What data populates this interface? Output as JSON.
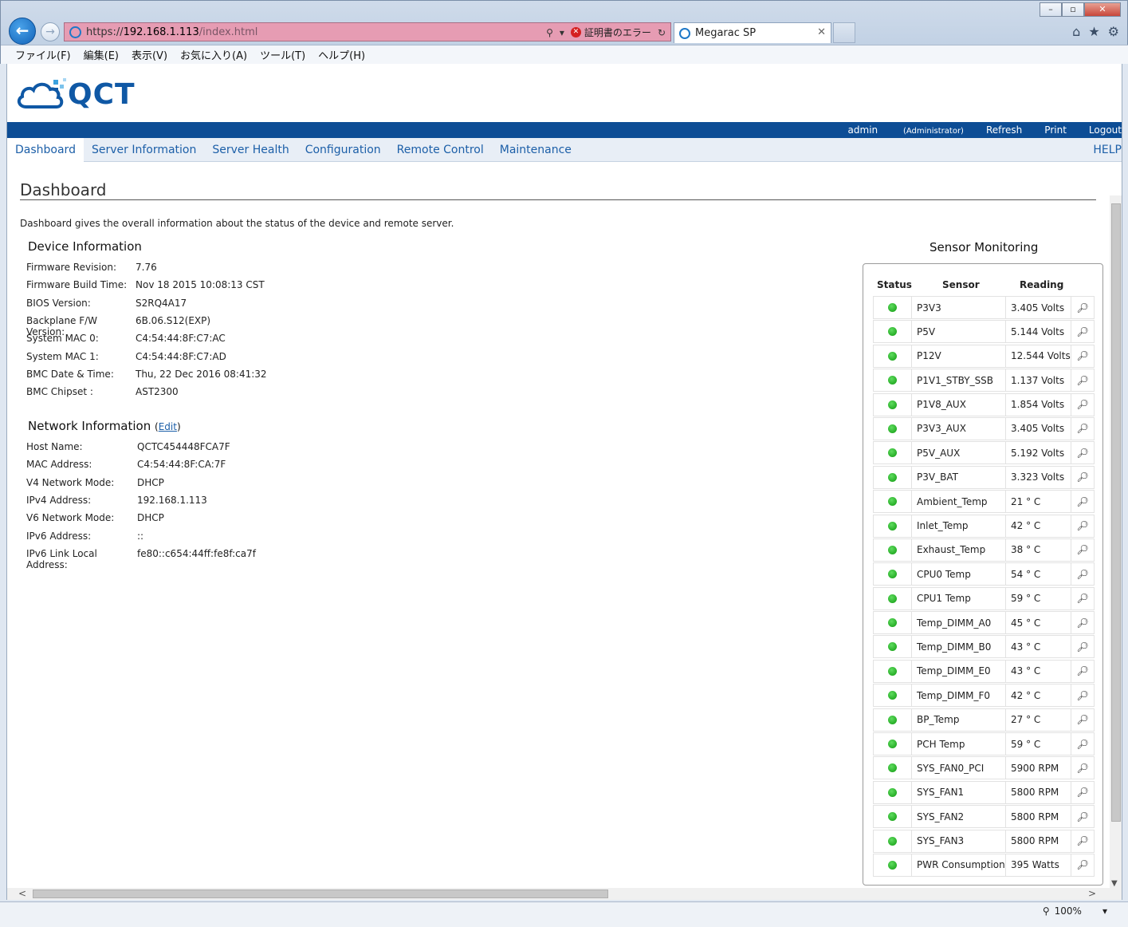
{
  "browser": {
    "url_prefix": "https://",
    "url_host": "192.168.1.113",
    "url_path": "/index.html",
    "cert_error": "証明書のエラー",
    "tab_title": "Megarac SP",
    "menus": [
      "ファイル(F)",
      "編集(E)",
      "表示(V)",
      "お気に入り(A)",
      "ツール(T)",
      "ヘルプ(H)"
    ],
    "zoom": "100%"
  },
  "header": {
    "logo": "QCT",
    "user": "admin",
    "role": "(Administrator)",
    "refresh": "Refresh",
    "print": "Print",
    "logout": "Logout"
  },
  "nav": {
    "items": [
      "Dashboard",
      "Server Information",
      "Server Health",
      "Configuration",
      "Remote Control",
      "Maintenance"
    ],
    "help": "HELP"
  },
  "page": {
    "title": "Dashboard",
    "description": "Dashboard gives the overall information about the status of the device and remote server."
  },
  "device": {
    "heading": "Device Information",
    "rows": [
      {
        "k": "Firmware Revision:",
        "v": "7.76"
      },
      {
        "k": "Firmware Build Time:",
        "v": "Nov 18 2015 10:08:13 CST"
      },
      {
        "k": "BIOS Version:",
        "v": "S2RQ4A17"
      },
      {
        "k": "Backplane F/W Version:",
        "v": "6B.06.S12(EXP)"
      },
      {
        "k": "System MAC 0:",
        "v": "C4:54:44:8F:C7:AC"
      },
      {
        "k": "System MAC 1:",
        "v": "C4:54:44:8F:C7:AD"
      },
      {
        "k": "BMC Date & Time:",
        "v": "Thu, 22 Dec 2016 08:41:32"
      },
      {
        "k": "BMC Chipset :",
        "v": "AST2300"
      }
    ]
  },
  "network": {
    "heading": "Network Information",
    "edit": "Edit",
    "rows": [
      {
        "k": "Host Name:",
        "v": "QCTC454448FCA7F"
      },
      {
        "k": "MAC Address:",
        "v": "C4:54:44:8F:CA:7F"
      },
      {
        "k": "V4 Network Mode:",
        "v": "DHCP"
      },
      {
        "k": "IPv4 Address:",
        "v": "192.168.1.113"
      },
      {
        "k": "V6 Network Mode:",
        "v": "DHCP"
      },
      {
        "k": "IPv6 Address:",
        "v": "::"
      },
      {
        "k": "IPv6 Link Local Address:",
        "v": "fe80::c654:44ff:fe8f:ca7f"
      }
    ]
  },
  "sensors": {
    "heading": "Sensor Monitoring",
    "col_status": "Status",
    "col_sensor": "Sensor",
    "col_reading": "Reading",
    "status_color": "#1a9e1a",
    "rows": [
      {
        "name": "P3V3",
        "reading": "3.405 Volts"
      },
      {
        "name": "P5V",
        "reading": "5.144 Volts"
      },
      {
        "name": "P12V",
        "reading": "12.544 Volts"
      },
      {
        "name": "P1V1_STBY_SSB",
        "reading": "1.137 Volts"
      },
      {
        "name": "P1V8_AUX",
        "reading": "1.854 Volts"
      },
      {
        "name": "P3V3_AUX",
        "reading": "3.405 Volts"
      },
      {
        "name": "P5V_AUX",
        "reading": "5.192 Volts"
      },
      {
        "name": "P3V_BAT",
        "reading": "3.323 Volts"
      },
      {
        "name": "Ambient_Temp",
        "reading": "21 ° C"
      },
      {
        "name": "Inlet_Temp",
        "reading": "42 ° C"
      },
      {
        "name": "Exhaust_Temp",
        "reading": "38 ° C"
      },
      {
        "name": "CPU0 Temp",
        "reading": "54 ° C"
      },
      {
        "name": "CPU1 Temp",
        "reading": "59 ° C"
      },
      {
        "name": "Temp_DIMM_A0",
        "reading": "45 ° C"
      },
      {
        "name": "Temp_DIMM_B0",
        "reading": "43 ° C"
      },
      {
        "name": "Temp_DIMM_E0",
        "reading": "43 ° C"
      },
      {
        "name": "Temp_DIMM_F0",
        "reading": "42 ° C"
      },
      {
        "name": "BP_Temp",
        "reading": "27 ° C"
      },
      {
        "name": "PCH Temp",
        "reading": "59 ° C"
      },
      {
        "name": "SYS_FAN0_PCI",
        "reading": "5900 RPM"
      },
      {
        "name": "SYS_FAN1",
        "reading": "5800 RPM"
      },
      {
        "name": "SYS_FAN2",
        "reading": "5800 RPM"
      },
      {
        "name": "SYS_FAN3",
        "reading": "5800 RPM"
      },
      {
        "name": "PWR Consumption",
        "reading": "395 Watts"
      }
    ]
  }
}
